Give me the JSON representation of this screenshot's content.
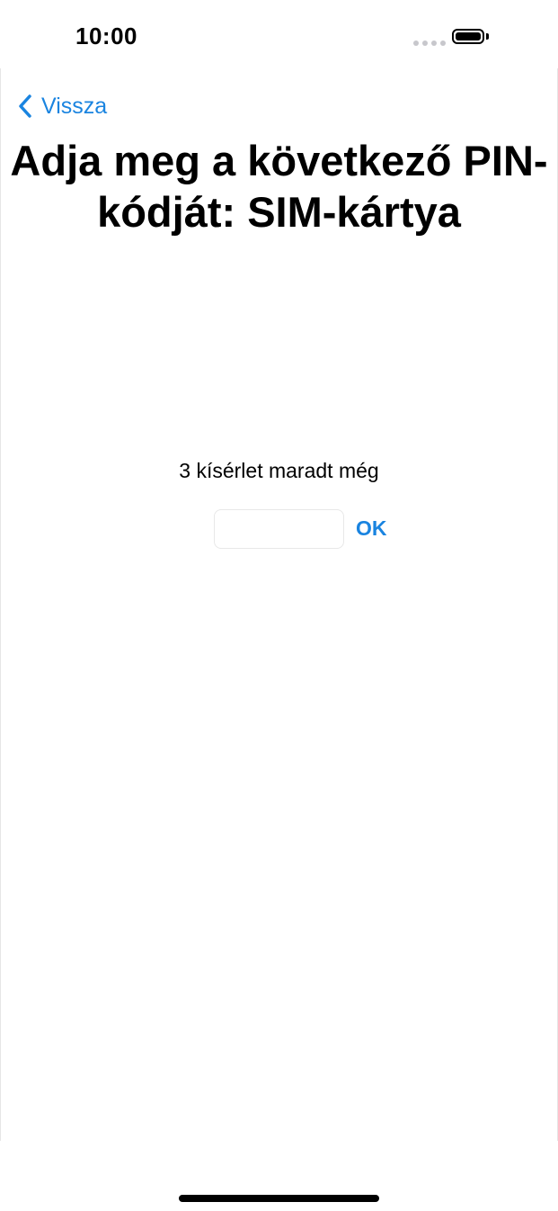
{
  "status_bar": {
    "time": "10:00"
  },
  "nav": {
    "back_label": "Vissza",
    "back_icon": "chevron-left-icon"
  },
  "title": "Adja meg a következő PIN-kódját: SIM-kártya",
  "attempts_text": "3 kísérlet maradt még",
  "pin_field": {
    "value": "",
    "placeholder": ""
  },
  "ok_label": "OK",
  "colors": {
    "accent": "#1a84e0",
    "text": "#000000",
    "background": "#ffffff"
  }
}
